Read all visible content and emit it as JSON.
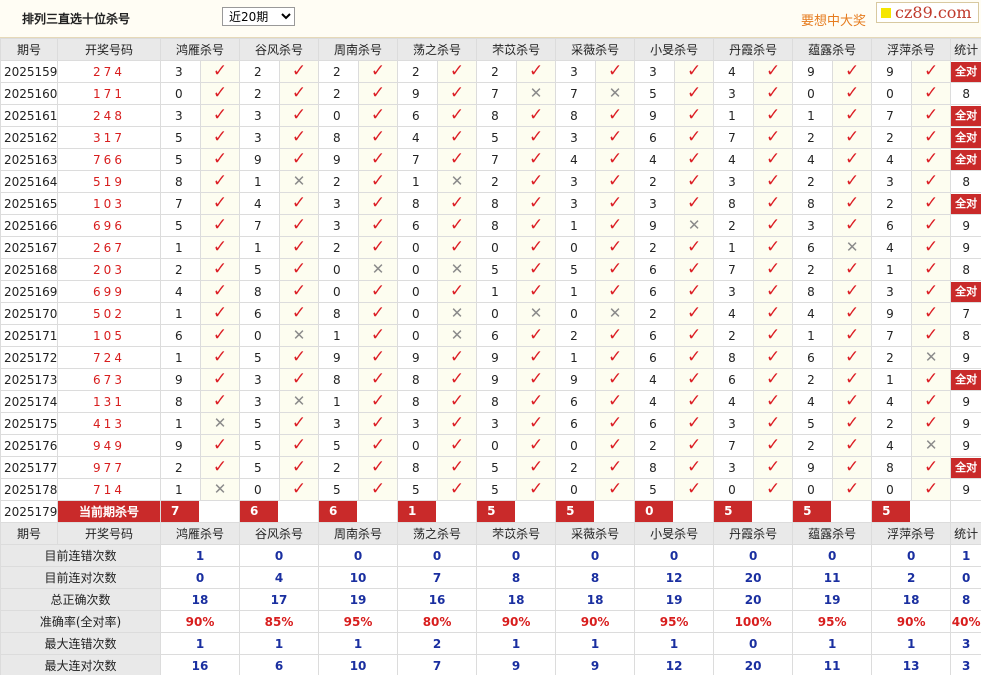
{
  "header": {
    "title": "排列三直选十位杀号",
    "period_select": "近20期",
    "promo": "要想中大奖",
    "logo": "cz89.com"
  },
  "columns": {
    "issue": "期号",
    "draw": "开奖号码",
    "methods": [
      "鸿雁杀号",
      "谷风杀号",
      "周南杀号",
      "荡之杀号",
      "芣苡杀号",
      "采薇杀号",
      "小旻杀号",
      "丹霞杀号",
      "蕴露杀号",
      "浮萍杀号"
    ],
    "stats": "统计"
  },
  "all_label": "全对",
  "rows": [
    {
      "issue": "2025159",
      "draw": "274",
      "kills": [
        3,
        2,
        2,
        2,
        2,
        3,
        3,
        4,
        9,
        9
      ],
      "hits": [
        1,
        1,
        1,
        1,
        1,
        1,
        1,
        1,
        1,
        1
      ],
      "stat": "全对"
    },
    {
      "issue": "2025160",
      "draw": "171",
      "kills": [
        0,
        2,
        2,
        9,
        7,
        7,
        5,
        3,
        0,
        0
      ],
      "hits": [
        1,
        1,
        1,
        1,
        0,
        0,
        1,
        1,
        1,
        1
      ],
      "stat": "8"
    },
    {
      "issue": "2025161",
      "draw": "248",
      "kills": [
        3,
        3,
        0,
        6,
        8,
        8,
        9,
        1,
        1,
        7
      ],
      "hits": [
        1,
        1,
        1,
        1,
        1,
        1,
        1,
        1,
        1,
        1
      ],
      "stat": "全对"
    },
    {
      "issue": "2025162",
      "draw": "317",
      "kills": [
        5,
        3,
        8,
        4,
        5,
        3,
        6,
        7,
        2,
        2
      ],
      "hits": [
        1,
        1,
        1,
        1,
        1,
        1,
        1,
        1,
        1,
        1
      ],
      "stat": "全对"
    },
    {
      "issue": "2025163",
      "draw": "766",
      "kills": [
        5,
        9,
        9,
        7,
        7,
        4,
        4,
        4,
        4,
        4
      ],
      "hits": [
        1,
        1,
        1,
        1,
        1,
        1,
        1,
        1,
        1,
        1
      ],
      "stat": "全对"
    },
    {
      "issue": "2025164",
      "draw": "519",
      "kills": [
        8,
        1,
        2,
        1,
        2,
        3,
        2,
        3,
        2,
        3
      ],
      "hits": [
        1,
        0,
        1,
        0,
        1,
        1,
        1,
        1,
        1,
        1
      ],
      "stat": "8"
    },
    {
      "issue": "2025165",
      "draw": "103",
      "kills": [
        7,
        4,
        3,
        8,
        8,
        3,
        3,
        8,
        8,
        2
      ],
      "hits": [
        1,
        1,
        1,
        1,
        1,
        1,
        1,
        1,
        1,
        1
      ],
      "stat": "全对"
    },
    {
      "issue": "2025166",
      "draw": "696",
      "kills": [
        5,
        7,
        3,
        6,
        8,
        1,
        9,
        2,
        3,
        6
      ],
      "hits": [
        1,
        1,
        1,
        1,
        1,
        1,
        0,
        1,
        1,
        1
      ],
      "stat": "9"
    },
    {
      "issue": "2025167",
      "draw": "267",
      "kills": [
        1,
        1,
        2,
        0,
        0,
        0,
        2,
        1,
        6,
        4
      ],
      "hits": [
        1,
        1,
        1,
        1,
        1,
        1,
        1,
        1,
        0,
        1
      ],
      "stat": "9"
    },
    {
      "issue": "2025168",
      "draw": "203",
      "kills": [
        2,
        5,
        0,
        0,
        5,
        5,
        6,
        7,
        2,
        1
      ],
      "hits": [
        1,
        1,
        0,
        0,
        1,
        1,
        1,
        1,
        1,
        1
      ],
      "stat": "8"
    },
    {
      "issue": "2025169",
      "draw": "699",
      "kills": [
        4,
        8,
        0,
        0,
        1,
        1,
        6,
        3,
        8,
        3
      ],
      "hits": [
        1,
        1,
        1,
        1,
        1,
        1,
        1,
        1,
        1,
        1
      ],
      "stat": "全对"
    },
    {
      "issue": "2025170",
      "draw": "502",
      "kills": [
        1,
        6,
        8,
        0,
        0,
        0,
        2,
        4,
        4,
        9
      ],
      "hits": [
        1,
        1,
        1,
        0,
        0,
        0,
        1,
        1,
        1,
        1
      ],
      "stat": "7"
    },
    {
      "issue": "2025171",
      "draw": "105",
      "kills": [
        6,
        0,
        1,
        0,
        6,
        2,
        6,
        2,
        1,
        7
      ],
      "hits": [
        1,
        0,
        1,
        0,
        1,
        1,
        1,
        1,
        1,
        1
      ],
      "stat": "8"
    },
    {
      "issue": "2025172",
      "draw": "724",
      "kills": [
        1,
        5,
        9,
        9,
        9,
        1,
        6,
        8,
        6,
        2
      ],
      "hits": [
        1,
        1,
        1,
        1,
        1,
        1,
        1,
        1,
        1,
        0
      ],
      "stat": "9"
    },
    {
      "issue": "2025173",
      "draw": "673",
      "kills": [
        9,
        3,
        8,
        8,
        9,
        9,
        4,
        6,
        2,
        1
      ],
      "hits": [
        1,
        1,
        1,
        1,
        1,
        1,
        1,
        1,
        1,
        1
      ],
      "stat": "全对"
    },
    {
      "issue": "2025174",
      "draw": "131",
      "kills": [
        8,
        3,
        1,
        8,
        8,
        6,
        4,
        4,
        4,
        4
      ],
      "hits": [
        1,
        0,
        1,
        1,
        1,
        1,
        1,
        1,
        1,
        1
      ],
      "stat": "9"
    },
    {
      "issue": "2025175",
      "draw": "413",
      "kills": [
        1,
        5,
        3,
        3,
        3,
        6,
        6,
        3,
        5,
        2
      ],
      "hits": [
        0,
        1,
        1,
        1,
        1,
        1,
        1,
        1,
        1,
        1
      ],
      "stat": "9"
    },
    {
      "issue": "2025176",
      "draw": "949",
      "kills": [
        9,
        5,
        5,
        0,
        0,
        0,
        2,
        7,
        2,
        4
      ],
      "hits": [
        1,
        1,
        1,
        1,
        1,
        1,
        1,
        1,
        1,
        0
      ],
      "stat": "9"
    },
    {
      "issue": "2025177",
      "draw": "977",
      "kills": [
        2,
        5,
        2,
        8,
        5,
        2,
        8,
        3,
        9,
        8
      ],
      "hits": [
        1,
        1,
        1,
        1,
        1,
        1,
        1,
        1,
        1,
        1
      ],
      "stat": "全对"
    },
    {
      "issue": "2025178",
      "draw": "714",
      "kills": [
        1,
        0,
        5,
        5,
        5,
        0,
        5,
        0,
        0,
        0
      ],
      "hits": [
        0,
        1,
        1,
        1,
        1,
        1,
        1,
        1,
        1,
        1
      ],
      "stat": "9"
    }
  ],
  "current": {
    "issue": "2025179",
    "label": "当前期杀号",
    "kills": [
      "7",
      "6",
      "6",
      "1",
      "5",
      "5",
      "0",
      "5",
      "5",
      "5"
    ]
  },
  "summary": [
    {
      "label": "目前连错次数",
      "values": [
        "1",
        "0",
        "0",
        "0",
        "0",
        "0",
        "0",
        "0",
        "0",
        "0"
      ],
      "stat": "1",
      "rate": false
    },
    {
      "label": "目前连对次数",
      "values": [
        "0",
        "4",
        "10",
        "7",
        "8",
        "8",
        "12",
        "20",
        "11",
        "2"
      ],
      "stat": "0",
      "rate": false
    },
    {
      "label": "总正确次数",
      "values": [
        "18",
        "17",
        "19",
        "16",
        "18",
        "18",
        "19",
        "20",
        "19",
        "18"
      ],
      "stat": "8",
      "rate": false
    },
    {
      "label": "准确率(全对率)",
      "values": [
        "90%",
        "85%",
        "95%",
        "80%",
        "90%",
        "90%",
        "95%",
        "100%",
        "95%",
        "90%"
      ],
      "stat": "40%",
      "rate": true
    },
    {
      "label": "最大连错次数",
      "values": [
        "1",
        "1",
        "1",
        "2",
        "1",
        "1",
        "1",
        "0",
        "1",
        "1"
      ],
      "stat": "3",
      "rate": false
    },
    {
      "label": "最大连对次数",
      "values": [
        "16",
        "6",
        "10",
        "7",
        "9",
        "9",
        "12",
        "20",
        "11",
        "13"
      ],
      "stat": "3",
      "rate": false
    }
  ],
  "marks": {
    "ok": "✓",
    "no": "✕"
  },
  "colors": {
    "accent_red": "#c92a2a",
    "draw_red": "#d81e1e",
    "value_blue": "#1a2fa0",
    "promo_orange": "#e67c1f",
    "header_gray": "#e9e9e9"
  }
}
